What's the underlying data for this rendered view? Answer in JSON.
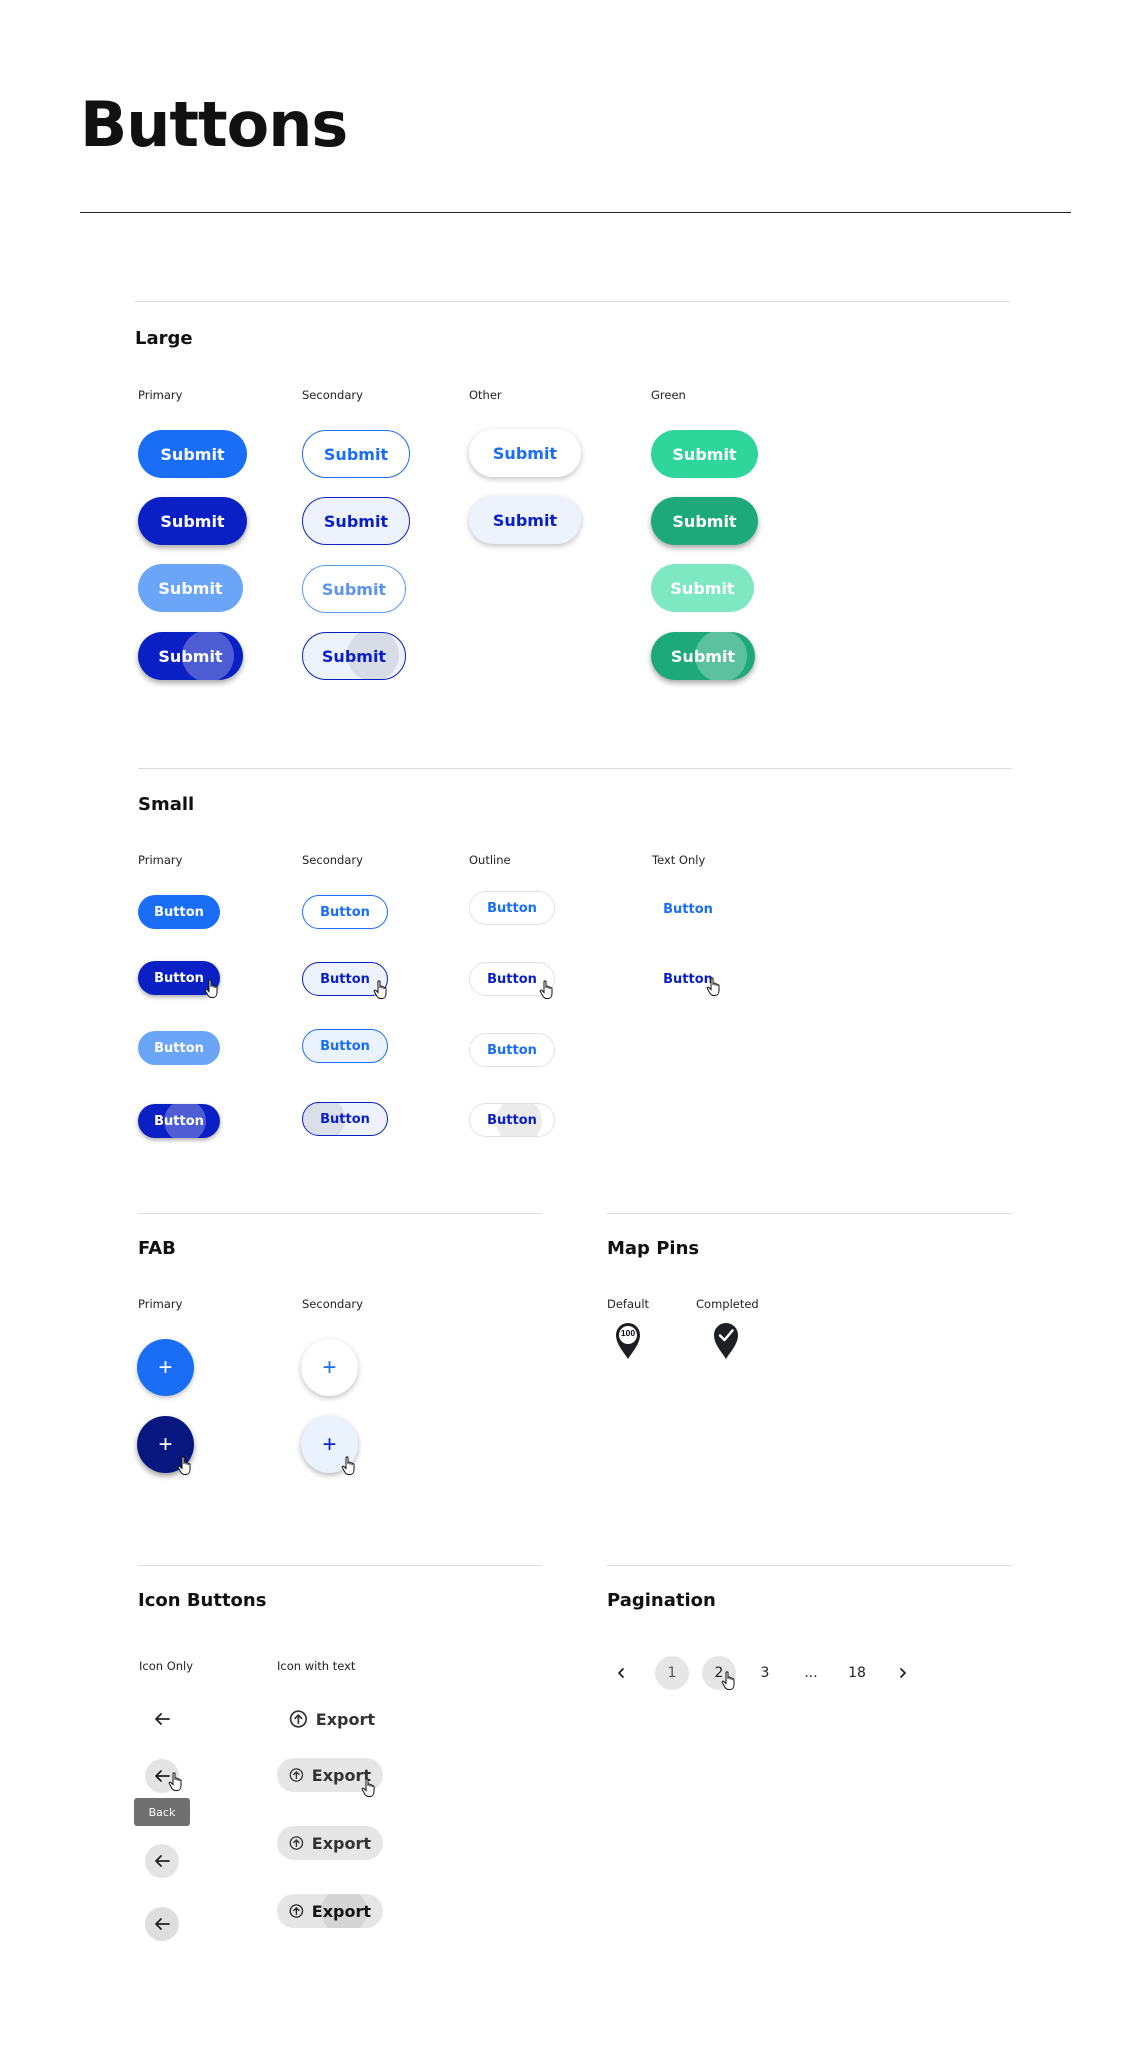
{
  "page": {
    "title": "Buttons"
  },
  "large": {
    "title": "Large",
    "labels": {
      "primary": "Primary",
      "secondary": "Secondary",
      "other": "Other",
      "green": "Green"
    },
    "button_label": "Submit"
  },
  "small": {
    "title": "Small",
    "labels": {
      "primary": "Primary",
      "secondary": "Secondary",
      "outline": "Outline",
      "text_only": "Text Only"
    },
    "button_label": "Button"
  },
  "fab": {
    "title": "FAB",
    "labels": {
      "primary": "Primary",
      "secondary": "Secondary"
    },
    "glyph": "+"
  },
  "map_pins": {
    "title": "Map Pins",
    "labels": {
      "default": "Default",
      "completed": "Completed"
    },
    "default_value": "100"
  },
  "icon_buttons": {
    "title": "Icon Buttons",
    "labels": {
      "icon_only": "Icon Only",
      "icon_with_text": "Icon with text"
    },
    "tooltip": "Back",
    "export_label": "Export",
    "icons": {
      "back": "arrow-left-icon",
      "export": "arrow-up-circle-icon"
    }
  },
  "pagination": {
    "title": "Pagination",
    "pages": [
      "1",
      "2",
      "3",
      "...",
      "18"
    ],
    "current": "1",
    "hovered": "2"
  },
  "colors": {
    "primary": "#1a6ef5",
    "primary_dark": "#0a1fc4",
    "primary_light": "#6aa5f7",
    "green": "#2ed69b",
    "green_dark": "#1ea97a",
    "green_light": "#7de8c2",
    "navy": "#07177f"
  }
}
